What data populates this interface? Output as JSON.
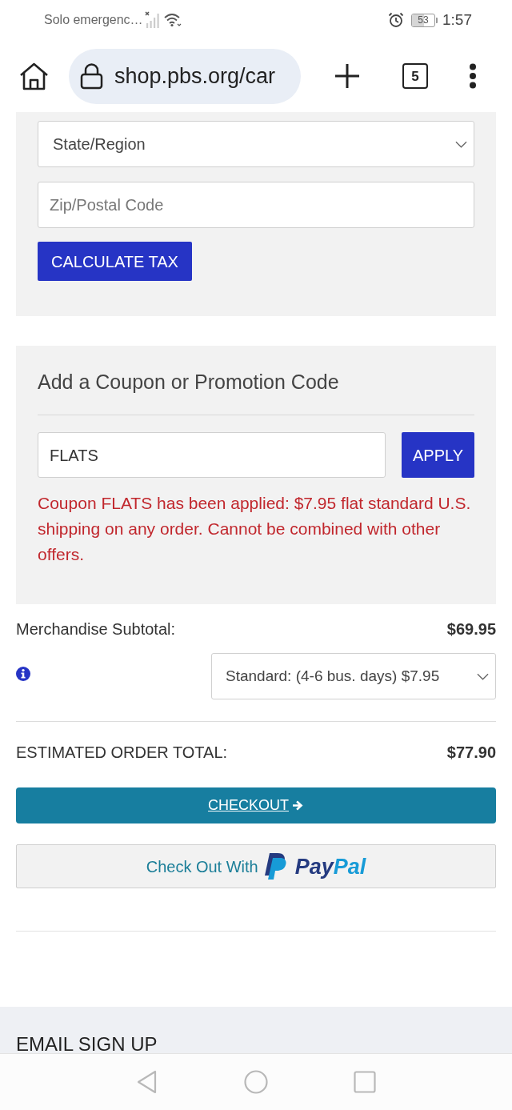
{
  "status_bar": {
    "carrier": "Solo emergenc…",
    "battery": "53",
    "time": "1:57"
  },
  "browser": {
    "url": "shop.pbs.org/car",
    "tab_count": "5"
  },
  "tax_form": {
    "state_select": {
      "value": "State/Region"
    },
    "zip_field": {
      "placeholder": "Zip/Postal Code"
    },
    "button": "CALCULATE TAX"
  },
  "coupon": {
    "heading": "Add a Coupon or Promotion Code",
    "field": {
      "value": "FLATS"
    },
    "button": "APPLY",
    "message": "Coupon FLATS has been applied: $7.95 flat standard U.S. shipping on any order. Cannot be combined with other offers."
  },
  "summary": {
    "subtotal": {
      "label": "Merchandise Subtotal:",
      "value": "$69.95"
    },
    "shipping_select": {
      "value": "Standard: (4-6 bus. days) $7.95"
    },
    "total": {
      "label": "ESTIMATED ORDER TOTAL:",
      "value": "$77.90"
    }
  },
  "checkout_button": "CHECKOUT",
  "paypal_button": {
    "label": "Check Out With",
    "logo": [
      {
        "text": "Pay",
        "color": "#253b80"
      },
      {
        "text": "Pal",
        "color": "#179bd7"
      }
    ]
  },
  "footer": {
    "heading": "EMAIL SIGN UP"
  }
}
